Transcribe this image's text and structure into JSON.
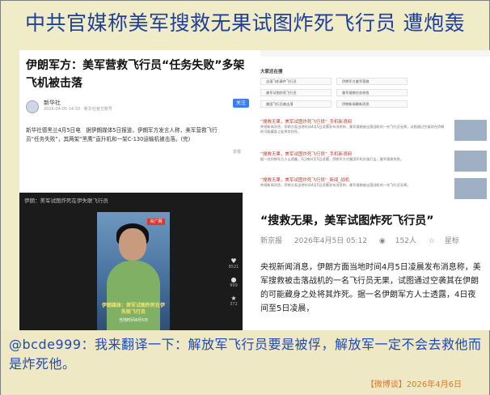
{
  "headline": "中共官媒称美军搜救无果试图炸死飞行员  遭炮轰",
  "left_card": {
    "title": "伊朗军方：美军营救飞行员“任务失败”多架飞机被击落",
    "source_name": "新华社",
    "source_meta": "2026-04-05 14:33 · 新华社官方账号",
    "follow_label": "关注",
    "body": "新华社德黑兰4月5日电　据伊朗媒体5日报道，伊朗军方发言人称，美军营救飞行员“任务失败”，其两架“黑鹰”直升机和一架C-130运输机被击落。(完)",
    "side_note": "举报"
  },
  "video": {
    "top_caption": "伊朗：美军试图炸死在伊失联飞行员",
    "tv_logo": "央广网",
    "caption_main": "伊朗媒体：美军试图炸死在伊失联飞行员",
    "caption_time": "当地时间4月5日",
    "side_counts": [
      "8521",
      "999",
      "372"
    ]
  },
  "right_panel": {
    "related_title": "大家还在搜",
    "chips": [
      "击落飞机事件飞行员",
      "伊朗军方美军营救",
      "美军试图炸死飞行员",
      "美军搜救任务失败",
      "美国飞行员被击落",
      "伊朗新闻最新消息"
    ],
    "results": [
      {
        "title": "“搜救无果，美军试图炸死飞行员”_手机新浪网",
        "text": "央视新闻消息，伊朗方面当地时间4月5日凌晨发布消息称，美军搜救被击落战机的一名飞行员无果，试图通过空袭其在伊朗的可能藏身之处将其炸死。"
      },
      {
        "title": "“搜救无果，美军试图炸死飞行员”_手机新浪网",
        "text": "据一名伊朗军方人士透露，4日夜间至5日凌晨，伊朗军方对美国军机实施打击，美军搜救失败。"
      },
      {
        "title": "“搜救无果，美军试图炸死飞行员”_新闻_战机",
        "text": "央视新闻消息，伊朗方面当地时间4月5日凌晨发布消息称，美军搜救被击落战机的一名飞行员无果。"
      }
    ],
    "article_title": "“搜救无果，美军试图炸死飞行员”",
    "article_source": "新京报",
    "article_time": "2026年4月5日 05:12",
    "article_views": "152人",
    "article_star": "星标",
    "article_body": "央视新闻消息，伊朗方面当地时间4月5日凌晨发布消息称，美军搜救被击落战机的一名飞行员无果，试图通过空袭其在伊朗的可能藏身之处将其炸死。据一名伊朗军方人士透露，4日夜间至5日凌晨，"
  },
  "comment": "@bcde999：我来翻译一下：解放军飞行员要是被俘，解放军一定不会去救他而是炸死他。",
  "credit": "【微博谈】2026年4月6日",
  "colors": {
    "headline": "#1f3f9a",
    "comment": "#1e4ab6",
    "credit": "#d8782c",
    "background": "#f1ecc8"
  }
}
